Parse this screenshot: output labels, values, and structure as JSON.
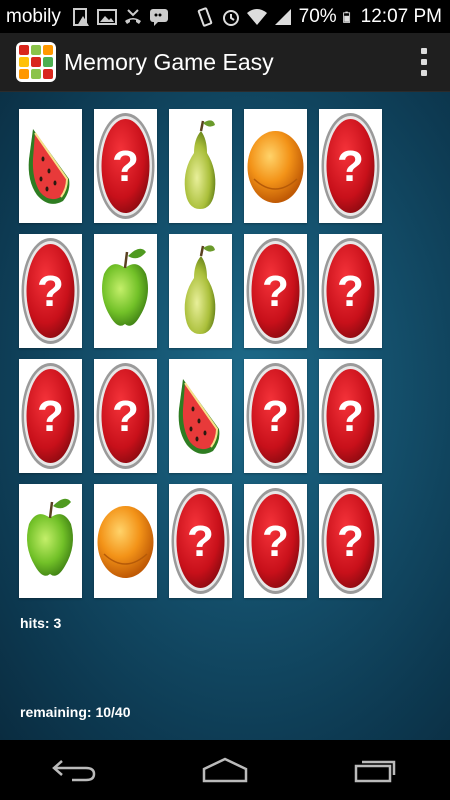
{
  "status_bar": {
    "carrier": "mobily",
    "battery": "70%",
    "time": "12:07 PM",
    "icons": [
      "warning-file-icon",
      "image-icon",
      "missed-call-icon",
      "bbm-icon",
      "vibrate-icon",
      "alarm-icon",
      "wifi-icon",
      "signal-icon",
      "battery-icon"
    ]
  },
  "app": {
    "title": "Memory Game Easy",
    "logo_icon": "fruit-grid-logo-icon",
    "menu_icon": "overflow-menu-icon"
  },
  "board": {
    "rows": 4,
    "cols": 5,
    "cards": [
      "watermelon",
      "hidden",
      "pear",
      "orange",
      "hidden",
      "hidden",
      "apple",
      "pear",
      "hidden",
      "hidden",
      "hidden",
      "hidden",
      "watermelon",
      "hidden",
      "hidden",
      "apple",
      "orange",
      "hidden",
      "hidden",
      "hidden"
    ]
  },
  "stats": {
    "hits": "hits: 3",
    "remaining": "remaining: 10/40"
  },
  "nav": {
    "back_icon": "back-icon",
    "home_icon": "home-icon",
    "recents_icon": "recent-apps-icon"
  },
  "colors": {
    "background": "#14506c",
    "card_back_red": "#d8141a",
    "action_bar": "#1f1f1f"
  }
}
